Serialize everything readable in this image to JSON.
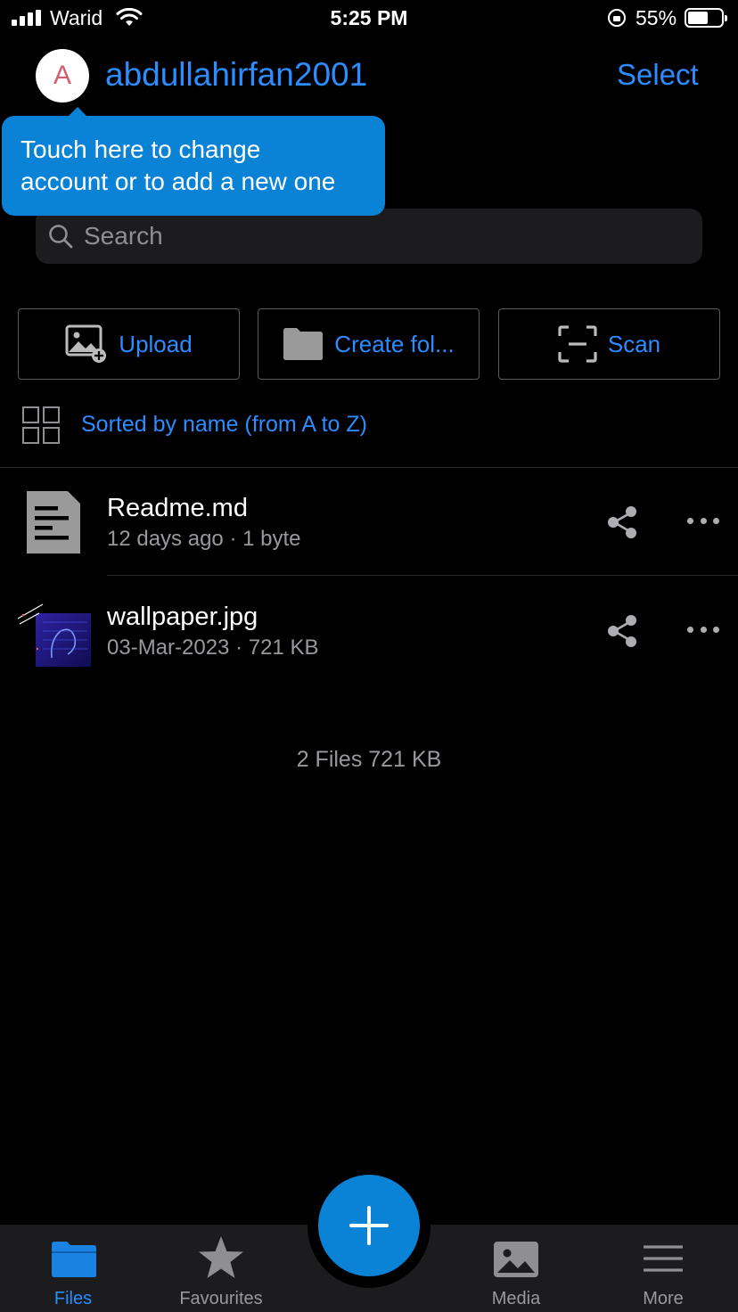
{
  "status_bar": {
    "carrier": "Warid",
    "time": "5:25 PM",
    "battery_percent": "55%",
    "battery_level": 0.55,
    "icons": [
      "signal-icon",
      "wifi-icon",
      "orientation-lock-icon",
      "battery-icon"
    ]
  },
  "header": {
    "avatar_letter": "A",
    "account_name": "abdullahirfan2001",
    "select_label": "Select"
  },
  "tooltip": {
    "line1": "Touch here to change",
    "line2": "account or to add a new one"
  },
  "search": {
    "placeholder": "Search"
  },
  "actions": {
    "upload_label": "Upload",
    "create_folder_label": "Create fol...",
    "scan_label": "Scan"
  },
  "sort": {
    "label": "Sorted by name (from A to Z)"
  },
  "files": [
    {
      "name": "Readme.md",
      "meta": "12 days ago · 1 byte",
      "icon": "document-icon"
    },
    {
      "name": "wallpaper.jpg",
      "meta": "03-Mar-2023 · 721 KB",
      "icon": "image-thumbnail"
    }
  ],
  "summary": "2 Files 721 KB",
  "tabbar": {
    "files": "Files",
    "favourites": "Favourites",
    "media": "Media",
    "more": "More",
    "active": "Files"
  },
  "colors": {
    "accent": "#2d8cff",
    "tooltip": "#0a82d6",
    "background": "#000000",
    "tabbar": "#1c1c1e"
  }
}
